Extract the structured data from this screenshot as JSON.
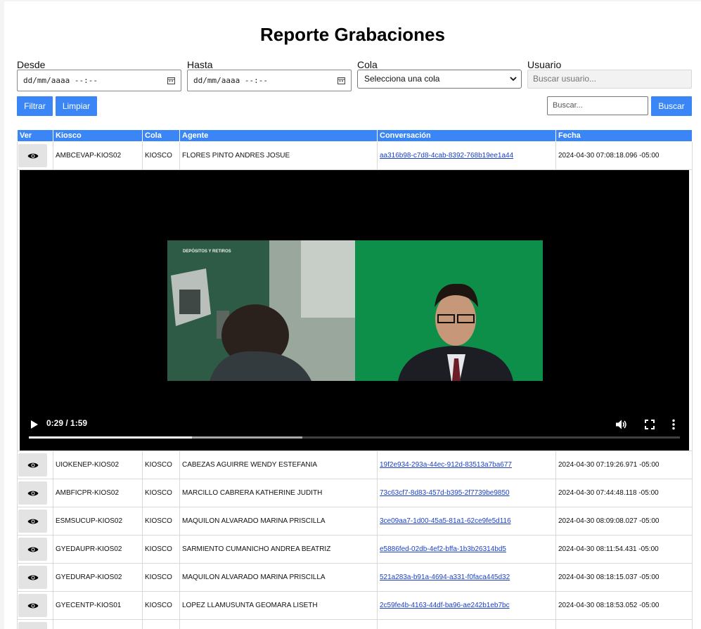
{
  "page": {
    "title": "Reporte Grabaciones"
  },
  "filters": {
    "desde": {
      "label": "Desde",
      "value": "dd/mm/aaaa --:--"
    },
    "hasta": {
      "label": "Hasta",
      "value": "dd/mm/aaaa --:--"
    },
    "cola": {
      "label": "Cola",
      "selected": "Selecciona una cola"
    },
    "usuario": {
      "label": "Usuario",
      "placeholder": "Buscar usuario..."
    }
  },
  "actions": {
    "filtrar": "Filtrar",
    "limpiar": "Limpiar",
    "search_placeholder": "Buscar...",
    "buscar": "Buscar"
  },
  "table": {
    "headers": [
      "Ver",
      "Kiosco",
      "Cola",
      "Agente",
      "Conversación",
      "Fecha"
    ],
    "rows": [
      {
        "kiosco": "AMBCEVAP-KIOS02",
        "cola": "KIOSCO",
        "agente": "FLORES PINTO ANDRES JOSUE",
        "conversacion": "aa316b98-c7d8-4cab-8392-768b19ee1a44",
        "fecha": "2024-04-30 07:08:18.096 -05:00"
      },
      {
        "kiosco": "UIOKENEP-KIOS02",
        "cola": "KIOSCO",
        "agente": "CABEZAS AGUIRRE WENDY ESTEFANIA",
        "conversacion": "19f2e934-293a-44ec-912d-83513a7ba677",
        "fecha": "2024-04-30 07:19:26.971 -05:00"
      },
      {
        "kiosco": "AMBFICPR-KIOS02",
        "cola": "KIOSCO",
        "agente": "MARCILLO CABRERA KATHERINE JUDITH",
        "conversacion": "73c63cf7-8d83-457d-b395-2f7739be9850",
        "fecha": "2024-04-30 07:44:48.118 -05:00"
      },
      {
        "kiosco": "ESMSUCUP-KIOS02",
        "cola": "KIOSCO",
        "agente": "MAQUILON ALVARADO MARINA PRISCILLA",
        "conversacion": "3ce09aa7-1d00-45a5-81a1-62ce9fe5d116",
        "fecha": "2024-04-30 08:09:08.027 -05:00"
      },
      {
        "kiosco": "GYEDAUPR-KIOS02",
        "cola": "KIOSCO",
        "agente": "SARMIENTO CUMANICHO ANDREA BEATRIZ",
        "conversacion": "e5886fed-02db-4ef2-bffa-1b3b26314bd5",
        "fecha": "2024-04-30 08:11:54.431 -05:00"
      },
      {
        "kiosco": "GYEDURAP-KIOS02",
        "cola": "KIOSCO",
        "agente": "MAQUILON ALVARADO MARINA PRISCILLA",
        "conversacion": "521a283a-b91a-4694-a331-f0faca445d32",
        "fecha": "2024-04-30 08:18:15.037 -05:00"
      },
      {
        "kiosco": "GYECENTP-KIOS01",
        "cola": "KIOSCO",
        "agente": "LOPEZ LLAMUSUNTA GEOMARA LISETH",
        "conversacion": "2c59fe4b-4163-44df-ba96-ae242b1eb7bc",
        "fecha": "2024-04-30 08:18:53.052 -05:00"
      }
    ]
  },
  "video": {
    "time_display": "0:29 / 1:59",
    "played_fraction": 0.25,
    "buffered_fraction": 0.42,
    "sign_text": "DEPÓSITOS Y RETIROS",
    "colors": {
      "green_screen": "#0d8f4a",
      "bank_wall": "#2e5b45"
    }
  },
  "colors": {
    "accent": "#3b86f7",
    "link": "#1a3fc8"
  }
}
